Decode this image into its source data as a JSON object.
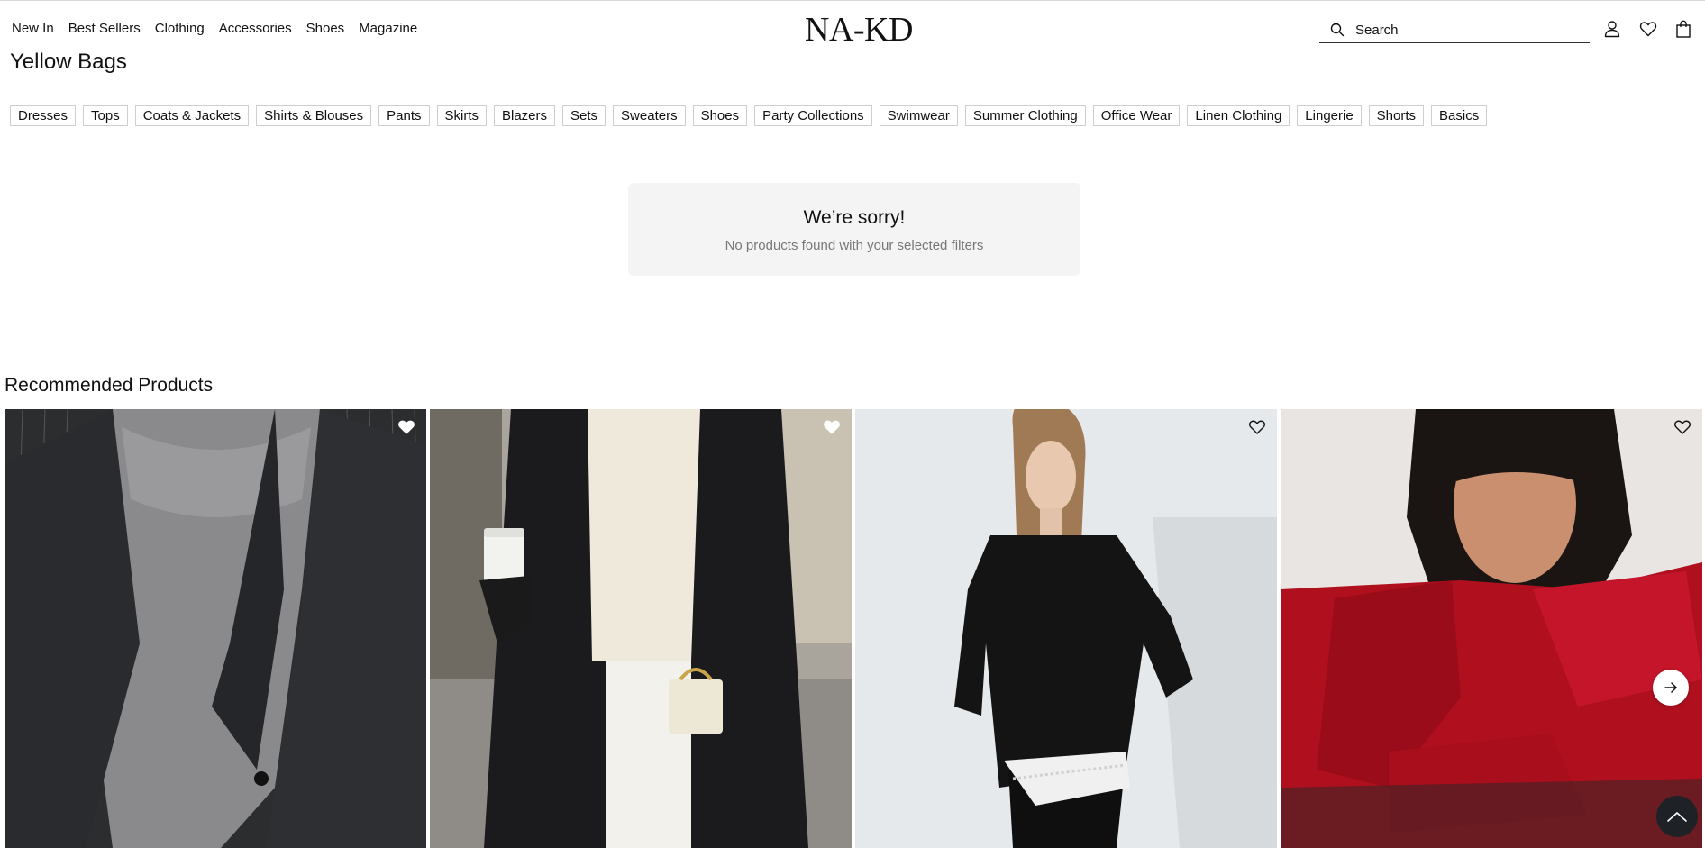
{
  "nav": {
    "items": [
      "New In",
      "Best Sellers",
      "Clothing",
      "Accessories",
      "Shoes",
      "Magazine"
    ]
  },
  "brand": {
    "logo": "NA-KD"
  },
  "search": {
    "placeholder": "Search"
  },
  "icons": {
    "search": "search-icon",
    "account": "user-icon",
    "wishlist": "heart-icon",
    "cart": "shopping-bag-icon",
    "next": "arrow-right-icon",
    "scroll_top": "chevron-up-icon"
  },
  "page": {
    "title": "Yellow Bags"
  },
  "categories": [
    "Dresses",
    "Tops",
    "Coats & Jackets",
    "Shirts & Blouses",
    "Pants",
    "Skirts",
    "Blazers",
    "Sets",
    "Sweaters",
    "Shoes",
    "Party Collections",
    "Swimwear",
    "Summer Clothing",
    "Office Wear",
    "Linen Clothing",
    "Lingerie",
    "Shorts",
    "Basics"
  ],
  "empty_state": {
    "heading": "We’re sorry!",
    "message": "No products found with your selected filters"
  },
  "recommended": {
    "title": "Recommended Products",
    "products": [
      {
        "image": "grey-sweater-pinstripe-blazer",
        "favorited": true
      },
      {
        "image": "cream-sweater-black-coat-bag",
        "favorited": true
      },
      {
        "image": "black-sweater-lace-slip-skirt",
        "favorited": false
      },
      {
        "image": "red-knit-sweater-scarf",
        "favorited": false
      }
    ]
  },
  "colors": {
    "text": "#111111",
    "chip_border": "#cfcfcf",
    "empty_bg": "#f4f4f4",
    "muted": "#777777",
    "scroll_top_bg": "#1e2226"
  }
}
